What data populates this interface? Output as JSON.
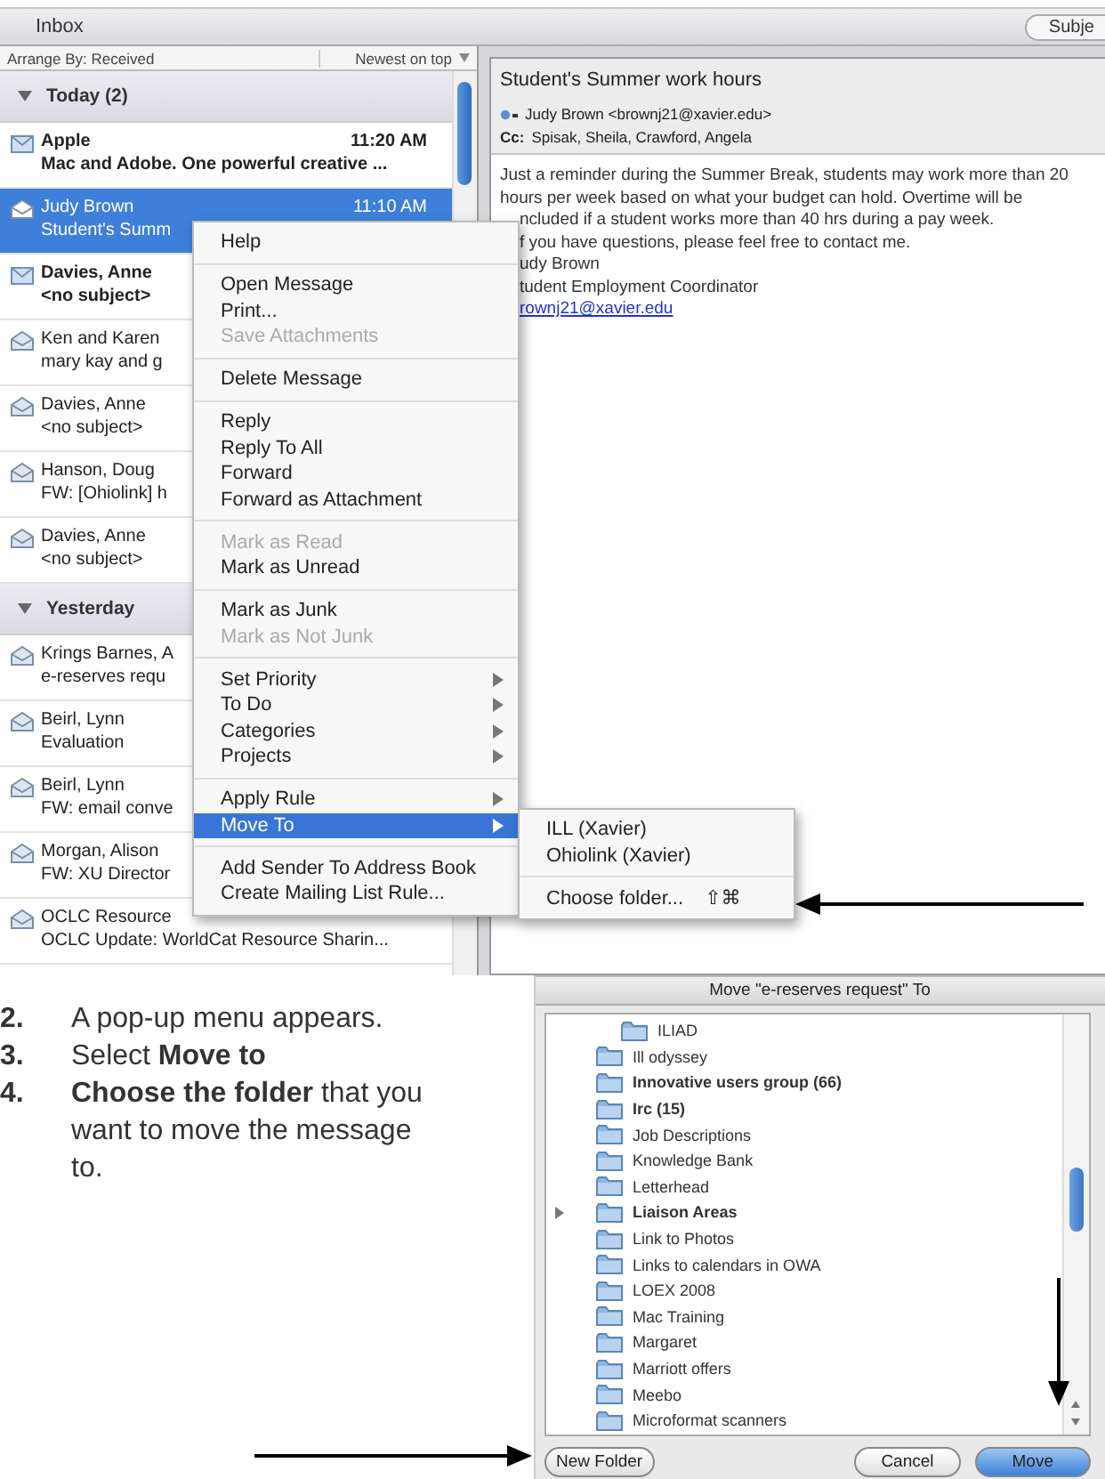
{
  "mail_window": {
    "folder_title": "Inbox",
    "toolbar_button": "Subje",
    "arrange_by": "Arrange By: Received",
    "sort_order": "Newest on top",
    "groups": [
      {
        "label": "Today (2)",
        "expanded": true,
        "messages": [
          {
            "sender": "Apple",
            "time": "11:20 AM",
            "subject": "Mac and Adobe. One powerful creative ...",
            "unread": true,
            "selected": false
          },
          {
            "sender": "Judy Brown",
            "time": "11:10 AM",
            "subject": "Student's Summ",
            "unread": false,
            "selected": true
          },
          {
            "sender": "Davies, Anne",
            "subject": "<no subject>",
            "unread": true,
            "selected": false
          },
          {
            "sender": "Ken and Karen",
            "subject": "mary kay and g",
            "unread": false,
            "selected": false
          },
          {
            "sender": "Davies, Anne",
            "subject": "<no subject>",
            "unread": false,
            "selected": false
          },
          {
            "sender": "Hanson, Doug",
            "subject": "FW: [Ohiolink] h",
            "unread": false,
            "selected": false
          },
          {
            "sender": "Davies, Anne",
            "subject": "<no subject>",
            "unread": false,
            "selected": false
          }
        ]
      },
      {
        "label": "Yesterday",
        "expanded": true,
        "messages": [
          {
            "sender": "Krings Barnes, A",
            "subject": "e-reserves requ",
            "unread": false,
            "selected": false
          },
          {
            "sender": "Beirl, Lynn",
            "subject": "Evaluation",
            "unread": false,
            "selected": false
          },
          {
            "sender": "Beirl, Lynn",
            "subject": "FW: email conve",
            "unread": false,
            "selected": false
          },
          {
            "sender": "Morgan, Alison",
            "subject": "FW: XU Director",
            "unread": false,
            "selected": false
          },
          {
            "sender": "OCLC Resource",
            "subject": "OCLC Update: WorldCat Resource Sharin...",
            "unread": false,
            "selected": false
          }
        ]
      }
    ],
    "reading_pane": {
      "subject": "Student's Summer work hours",
      "from": "Judy Brown <brownj21@xavier.edu>",
      "cc_label": "Cc:",
      "cc": "Spisak, Sheila, Crawford, Angela",
      "body_lines": [
        {
          "kind": "text",
          "text": "Just a reminder during the Summer Break, students may work more than 20"
        },
        {
          "kind": "text",
          "text": "hours per week based on what your budget can hold. Overtime will be"
        },
        {
          "kind": "text",
          "text": "ncluded if a student works more than 40 hrs during a pay week."
        },
        {
          "kind": "text",
          "text": "f you have questions, please feel free to contact me."
        },
        {
          "kind": "text",
          "text": "udy Brown"
        },
        {
          "kind": "text",
          "text": "tudent Employment Coordinator"
        },
        {
          "kind": "link",
          "text": "rownj21@xavier.edu"
        }
      ]
    },
    "context_menu": {
      "items": [
        {
          "kind": "item",
          "label": "Help",
          "disabled": false,
          "submenu": false,
          "selected": false
        },
        {
          "kind": "separator"
        },
        {
          "kind": "item",
          "label": "Open Message",
          "disabled": false,
          "submenu": false,
          "selected": false
        },
        {
          "kind": "item",
          "label": "Print...",
          "disabled": false,
          "submenu": false,
          "selected": false
        },
        {
          "kind": "item",
          "label": "Save Attachments",
          "disabled": true,
          "submenu": false,
          "selected": false
        },
        {
          "kind": "separator"
        },
        {
          "kind": "item",
          "label": "Delete Message",
          "disabled": false,
          "submenu": false,
          "selected": false
        },
        {
          "kind": "separator"
        },
        {
          "kind": "item",
          "label": "Reply",
          "disabled": false,
          "submenu": false,
          "selected": false
        },
        {
          "kind": "item",
          "label": "Reply To All",
          "disabled": false,
          "submenu": false,
          "selected": false
        },
        {
          "kind": "item",
          "label": "Forward",
          "disabled": false,
          "submenu": false,
          "selected": false
        },
        {
          "kind": "item",
          "label": "Forward as Attachment",
          "disabled": false,
          "submenu": false,
          "selected": false
        },
        {
          "kind": "separator"
        },
        {
          "kind": "item",
          "label": "Mark as Read",
          "disabled": true,
          "submenu": false,
          "selected": false
        },
        {
          "kind": "item",
          "label": "Mark as Unread",
          "disabled": false,
          "submenu": false,
          "selected": false
        },
        {
          "kind": "separator"
        },
        {
          "kind": "item",
          "label": "Mark as Junk",
          "disabled": false,
          "submenu": false,
          "selected": false
        },
        {
          "kind": "item",
          "label": "Mark as Not Junk",
          "disabled": true,
          "submenu": false,
          "selected": false
        },
        {
          "kind": "separator"
        },
        {
          "kind": "item",
          "label": "Set Priority",
          "disabled": false,
          "submenu": true,
          "selected": false
        },
        {
          "kind": "item",
          "label": "To Do",
          "disabled": false,
          "submenu": true,
          "selected": false
        },
        {
          "kind": "item",
          "label": "Categories",
          "disabled": false,
          "submenu": true,
          "selected": false
        },
        {
          "kind": "item",
          "label": "Projects",
          "disabled": false,
          "submenu": true,
          "selected": false
        },
        {
          "kind": "separator"
        },
        {
          "kind": "item",
          "label": "Apply Rule",
          "disabled": false,
          "submenu": true,
          "selected": false
        },
        {
          "kind": "item",
          "label": "Move To",
          "disabled": false,
          "submenu": true,
          "selected": true
        },
        {
          "kind": "separator"
        },
        {
          "kind": "item",
          "label": "Add Sender To Address Book",
          "disabled": false,
          "submenu": false,
          "selected": false
        },
        {
          "kind": "item",
          "label": "Create Mailing List Rule...",
          "disabled": false,
          "submenu": false,
          "selected": false
        }
      ]
    },
    "submenu": {
      "items": [
        {
          "kind": "item",
          "label": "ILL (Xavier)"
        },
        {
          "kind": "item",
          "label": "Ohiolink (Xavier)"
        },
        {
          "kind": "separator"
        },
        {
          "kind": "item",
          "label": "Choose folder...",
          "shortcut": "⇧⌘"
        }
      ]
    }
  },
  "instructions": [
    {
      "number": "2.",
      "text": "A pop-up menu appears."
    },
    {
      "number": "3.",
      "text": "Select **Move to**"
    },
    {
      "number": "4.",
      "text": "**Choose the folder** that you want to move the message to."
    }
  ],
  "move_dialog": {
    "title": "Move \"e-reserves request\" To",
    "folders": [
      {
        "kind": "nested",
        "name": "ILIAD",
        "unread": false,
        "expandable": false
      },
      {
        "kind": "folder",
        "name": "Ill odyssey",
        "unread": false,
        "expandable": false
      },
      {
        "kind": "folder",
        "name": "Innovative users group (66)",
        "unread": true,
        "expandable": false
      },
      {
        "kind": "folder",
        "name": "Irc (15)",
        "unread": true,
        "expandable": false
      },
      {
        "kind": "folder",
        "name": "Job Descriptions",
        "unread": false,
        "expandable": false
      },
      {
        "kind": "folder",
        "name": "Knowledge Bank",
        "unread": false,
        "expandable": false
      },
      {
        "kind": "folder",
        "name": "Letterhead",
        "unread": false,
        "expandable": false
      },
      {
        "kind": "folder",
        "name": "Liaison Areas",
        "unread": true,
        "expandable": true
      },
      {
        "kind": "folder",
        "name": "Link to Photos",
        "unread": false,
        "expandable": false
      },
      {
        "kind": "folder",
        "name": "Links to calendars in OWA",
        "unread": false,
        "expandable": false
      },
      {
        "kind": "folder",
        "name": "LOEX 2008",
        "unread": false,
        "expandable": false
      },
      {
        "kind": "folder",
        "name": "Mac Training",
        "unread": false,
        "expandable": false
      },
      {
        "kind": "folder",
        "name": "Margaret",
        "unread": false,
        "expandable": false
      },
      {
        "kind": "folder",
        "name": "Marriott offers",
        "unread": false,
        "expandable": false
      },
      {
        "kind": "folder",
        "name": "Meebo",
        "unread": false,
        "expandable": false
      },
      {
        "kind": "folder",
        "name": "Microformat scanners",
        "unread": false,
        "expandable": false
      }
    ],
    "buttons": [
      {
        "label": "New Folder",
        "default": false
      },
      {
        "label": "Cancel",
        "default": false
      },
      {
        "label": "Move",
        "default": true
      }
    ]
  }
}
